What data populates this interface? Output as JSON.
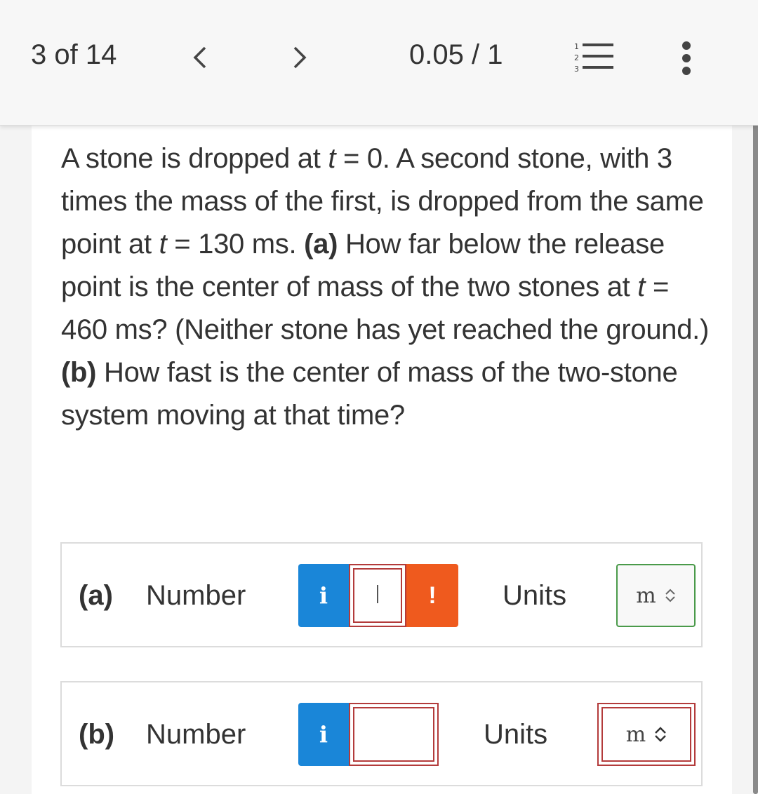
{
  "header": {
    "counter": "3 of 14",
    "score": "0.05 / 1",
    "icons": [
      "chevron-left-icon",
      "chevron-right-icon",
      "numbered-list-icon",
      "more-vertical-icon"
    ]
  },
  "question": {
    "segments": [
      {
        "t": "A stone is dropped at "
      },
      {
        "t": "t",
        "style": "italic"
      },
      {
        "t": " = 0. A second stone, with 3 times the mass of the first, is dropped from the same point at "
      },
      {
        "t": "t",
        "style": "italic"
      },
      {
        "t": " = 130 ms. "
      },
      {
        "t": "(a)",
        "style": "bold"
      },
      {
        "t": " How far below the release point is the center of mass of the two stones at "
      },
      {
        "t": "t",
        "style": "italic"
      },
      {
        "t": " = 460 ms? (Neither stone has yet reached the ground.) "
      },
      {
        "t": "(b)",
        "style": "bold"
      },
      {
        "t": " How fast is the center of mass of the two-stone system moving at that time?"
      }
    ]
  },
  "answers": {
    "a": {
      "part_label": "(a)",
      "number_label": "Number",
      "info_glyph": "i",
      "value": "",
      "alert_glyph": "!",
      "units_label": "Units",
      "units_value": "m"
    },
    "b": {
      "part_label": "(b)",
      "number_label": "Number",
      "info_glyph": "i",
      "value": "",
      "units_label": "Units",
      "units_value": "m"
    }
  },
  "colors": {
    "info_blue": "#1a86d8",
    "alert_orange": "#ef5a1e",
    "error_red": "#b33b3b",
    "ok_green": "#4a9a4a"
  }
}
